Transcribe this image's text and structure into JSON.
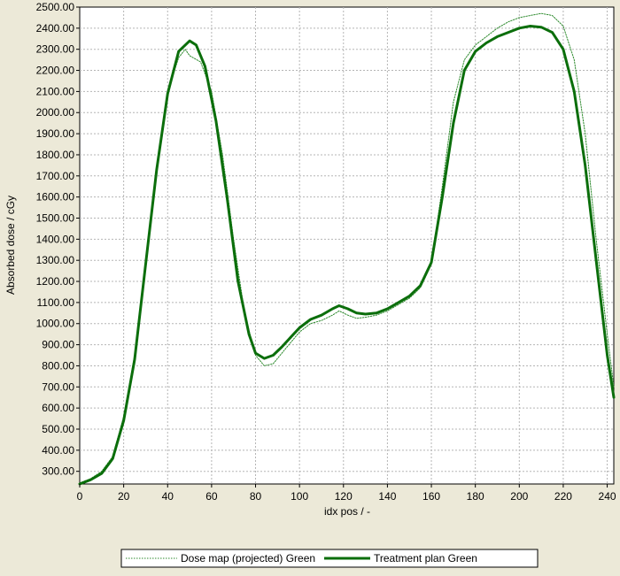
{
  "chart_data": {
    "type": "line",
    "title": "",
    "xlabel": "idx pos / -",
    "ylabel": "Absorbed dose / cGy",
    "xlim": [
      0,
      243
    ],
    "ylim": [
      240,
      2500
    ],
    "x_ticks": [
      0,
      20,
      40,
      60,
      80,
      100,
      120,
      140,
      160,
      180,
      200,
      220,
      240
    ],
    "x_tick_labels": [
      "0",
      "20",
      "40",
      "60",
      "80",
      "100",
      "120",
      "140",
      "160",
      "180",
      "200",
      "220",
      "240"
    ],
    "y_ticks": [
      300,
      400,
      500,
      600,
      700,
      800,
      900,
      1000,
      1100,
      1200,
      1300,
      1400,
      1500,
      1600,
      1700,
      1800,
      1900,
      2000,
      2100,
      2200,
      2300,
      2400,
      2500
    ],
    "y_tick_labels": [
      "300.00",
      "400.00",
      "500.00",
      "600.00",
      "700.00",
      "800.00",
      "900.00",
      "1000.00",
      "1100.00",
      "1200.00",
      "1300.00",
      "1400.00",
      "1500.00",
      "1600.00",
      "1700.00",
      "1800.00",
      "1900.00",
      "2000.00",
      "2100.00",
      "2200.00",
      "2300.00",
      "2400.00",
      "2500.00"
    ],
    "grid": true,
    "legend_position": "bottom",
    "series": [
      {
        "name": "Dose map (projected) Green",
        "color": "#2e8b2e",
        "style": "dotted",
        "points": [
          [
            0,
            245
          ],
          [
            5,
            265
          ],
          [
            10,
            300
          ],
          [
            15,
            370
          ],
          [
            20,
            560
          ],
          [
            25,
            850
          ],
          [
            30,
            1300
          ],
          [
            35,
            1750
          ],
          [
            40,
            2100
          ],
          [
            45,
            2260
          ],
          [
            48,
            2300
          ],
          [
            50,
            2270
          ],
          [
            55,
            2240
          ],
          [
            60,
            2100
          ],
          [
            65,
            1800
          ],
          [
            70,
            1400
          ],
          [
            75,
            1050
          ],
          [
            80,
            850
          ],
          [
            84,
            800
          ],
          [
            88,
            810
          ],
          [
            92,
            860
          ],
          [
            100,
            960
          ],
          [
            105,
            1000
          ],
          [
            110,
            1015
          ],
          [
            115,
            1040
          ],
          [
            118,
            1060
          ],
          [
            122,
            1040
          ],
          [
            126,
            1025
          ],
          [
            130,
            1030
          ],
          [
            135,
            1040
          ],
          [
            140,
            1060
          ],
          [
            145,
            1090
          ],
          [
            150,
            1120
          ],
          [
            155,
            1170
          ],
          [
            160,
            1280
          ],
          [
            165,
            1650
          ],
          [
            170,
            2050
          ],
          [
            175,
            2250
          ],
          [
            180,
            2320
          ],
          [
            185,
            2360
          ],
          [
            190,
            2400
          ],
          [
            195,
            2430
          ],
          [
            200,
            2450
          ],
          [
            205,
            2460
          ],
          [
            210,
            2470
          ],
          [
            215,
            2460
          ],
          [
            220,
            2410
          ],
          [
            225,
            2250
          ],
          [
            230,
            1900
          ],
          [
            235,
            1400
          ],
          [
            240,
            950
          ],
          [
            243,
            700
          ]
        ]
      },
      {
        "name": "Treatment plan Green",
        "color": "#0b6e0b",
        "style": "solid",
        "points": [
          [
            0,
            240
          ],
          [
            5,
            260
          ],
          [
            10,
            290
          ],
          [
            15,
            360
          ],
          [
            20,
            540
          ],
          [
            25,
            830
          ],
          [
            30,
            1280
          ],
          [
            35,
            1730
          ],
          [
            40,
            2090
          ],
          [
            45,
            2290
          ],
          [
            50,
            2340
          ],
          [
            53,
            2320
          ],
          [
            57,
            2220
          ],
          [
            62,
            1960
          ],
          [
            67,
            1600
          ],
          [
            72,
            1200
          ],
          [
            77,
            950
          ],
          [
            80,
            860
          ],
          [
            84,
            835
          ],
          [
            88,
            850
          ],
          [
            92,
            890
          ],
          [
            96,
            935
          ],
          [
            100,
            980
          ],
          [
            105,
            1020
          ],
          [
            110,
            1040
          ],
          [
            115,
            1070
          ],
          [
            118,
            1085
          ],
          [
            122,
            1070
          ],
          [
            126,
            1050
          ],
          [
            130,
            1045
          ],
          [
            135,
            1050
          ],
          [
            140,
            1070
          ],
          [
            145,
            1100
          ],
          [
            150,
            1130
          ],
          [
            155,
            1180
          ],
          [
            160,
            1290
          ],
          [
            165,
            1600
          ],
          [
            170,
            1950
          ],
          [
            175,
            2200
          ],
          [
            180,
            2290
          ],
          [
            185,
            2330
          ],
          [
            190,
            2360
          ],
          [
            195,
            2380
          ],
          [
            200,
            2400
          ],
          [
            205,
            2410
          ],
          [
            210,
            2405
          ],
          [
            215,
            2380
          ],
          [
            220,
            2300
          ],
          [
            225,
            2100
          ],
          [
            230,
            1750
          ],
          [
            235,
            1300
          ],
          [
            240,
            850
          ],
          [
            243,
            650
          ]
        ]
      }
    ]
  }
}
